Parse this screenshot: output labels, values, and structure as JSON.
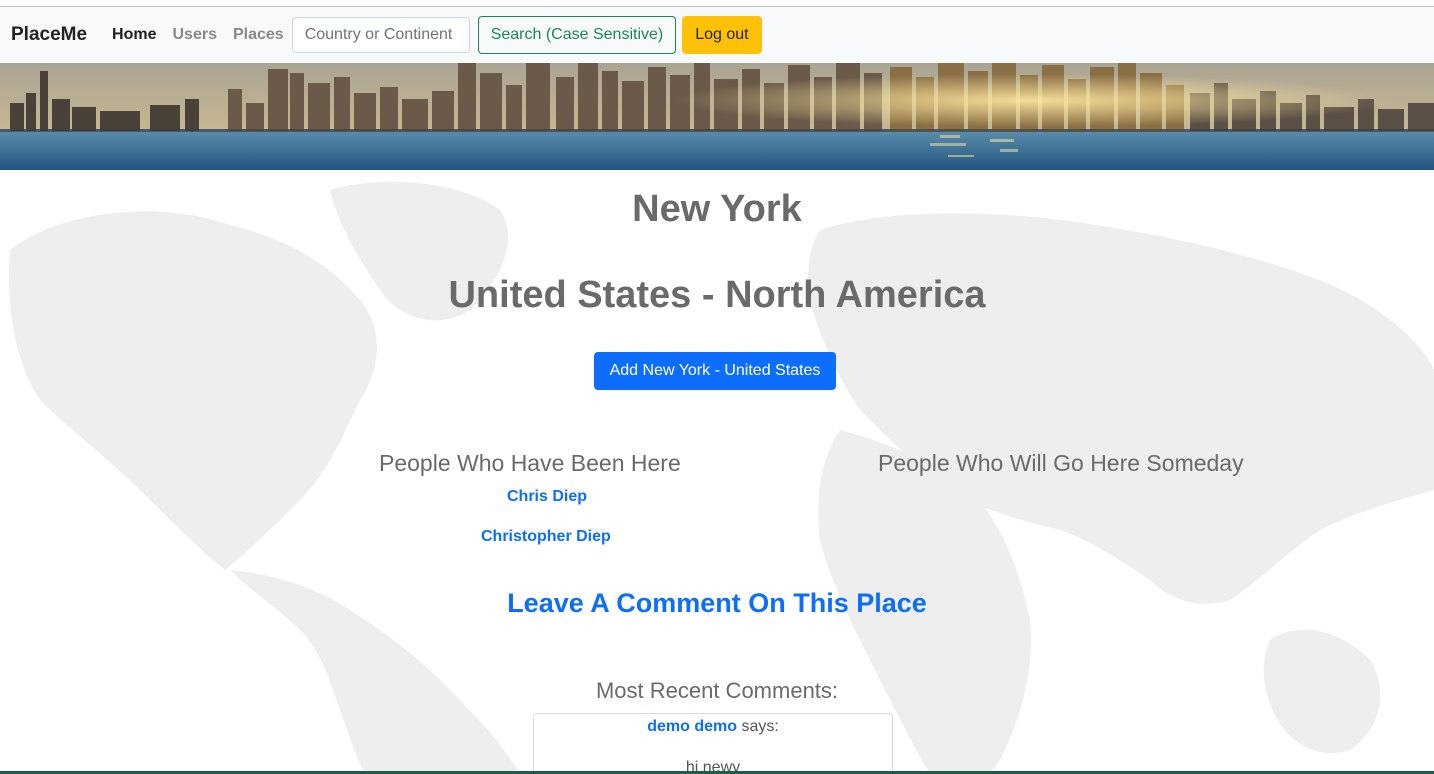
{
  "navbar": {
    "brand": "PlaceMe",
    "links": [
      {
        "label": "Home",
        "active": true
      },
      {
        "label": "Users",
        "active": false
      },
      {
        "label": "Places",
        "active": false
      }
    ],
    "search": {
      "placeholder": "Country or Continent",
      "value": ""
    },
    "search_button": "Search (Case Sensitive)",
    "logout_button": "Log out"
  },
  "banner": {
    "image": "new-york-skyline-photo"
  },
  "place": {
    "city": "New York",
    "country_continent": "United States - North America",
    "add_button": "Add New York - United States"
  },
  "been_here": {
    "title": "People Who Have Been Here",
    "people": [
      "Chris Diep",
      "Christopher Diep"
    ]
  },
  "will_go": {
    "title": "People Who Will Go Here Someday",
    "people": []
  },
  "comment_link": "Leave A Comment On This Place",
  "recent_comments": {
    "title": "Most Recent Comments:",
    "items": [
      {
        "author": "demo demo",
        "says": "says:",
        "text": "hi newy"
      }
    ]
  },
  "colors": {
    "primary": "#0d6efd",
    "success": "#198754",
    "warning": "#ffc107",
    "heading": "#6a6a6a",
    "navbar_bg": "#f8f9fa"
  }
}
